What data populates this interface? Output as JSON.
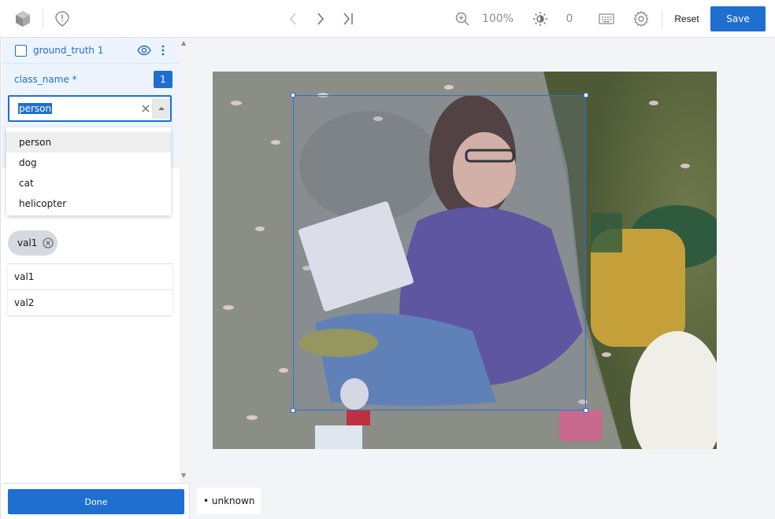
{
  "toolbar": {
    "zoom_level": "100%",
    "brightness_value": "0",
    "reset_label": "Reset",
    "save_label": "Save"
  },
  "panel": {
    "ground_truth_label": "ground_truth 1",
    "attribute_label": "class_name *",
    "attribute_count": "1",
    "combo_value": "person",
    "dropdown_options": [
      "person",
      "dog",
      "cat",
      "helicopter"
    ],
    "tag_label": "val1",
    "value_list": [
      "val1",
      "val2"
    ],
    "done_label": "Done"
  },
  "canvas": {
    "annotation_chip": "• unknown"
  },
  "colors": {
    "accent": "#1f6fd1",
    "panel_highlight": "#edf4fd"
  }
}
